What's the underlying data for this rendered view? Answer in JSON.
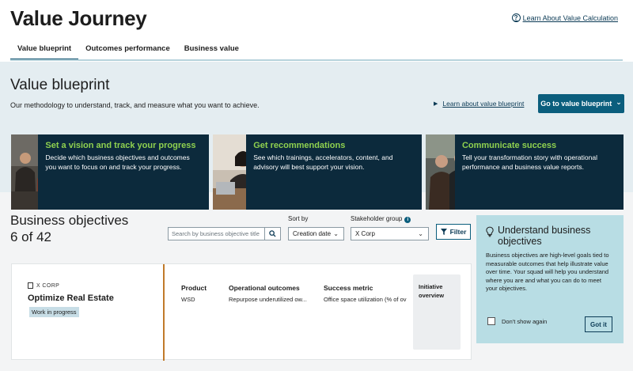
{
  "header": {
    "app_title": "Value Journey",
    "help_link": "Learn About Value Calculation"
  },
  "tabs": [
    {
      "label": "Value blueprint",
      "active": true
    },
    {
      "label": "Outcomes performance",
      "active": false
    },
    {
      "label": "Business value",
      "active": false
    }
  ],
  "blueprint": {
    "title": "Value blueprint",
    "description": "Our methodology to understand, track, and measure what you want to achieve.",
    "learn_link": "Learn about value blueprint",
    "cta": "Go to value blueprint",
    "cta_chevron": "⌄"
  },
  "cards": [
    {
      "title": "Set a vision and track your progress",
      "text": "Decide which business objectives and outcomes you want to focus on and track your progress."
    },
    {
      "title": "Get recommendations",
      "text": "See which trainings, accelerators, content, and advisory will best support your vision."
    },
    {
      "title": "Communicate success",
      "text": "Tell your transformation story with operational performance and business value reports."
    }
  ],
  "objectives": {
    "title": "Business objectives",
    "count": "6 of 42",
    "search_placeholder": "Search by business objective title",
    "sort_label": "Sort by",
    "sort_value": "Creation date",
    "stakeholder_label": "Stakeholder group",
    "stakeholder_value": "X Corp",
    "filter_label": "Filter"
  },
  "objective_card": {
    "company": "X CORP",
    "name": "Optimize Real Estate",
    "status": "Work in progress",
    "columns": [
      {
        "header": "Product",
        "value": "WSD"
      },
      {
        "header": "Operational outcomes",
        "value": "Repurpose underutilized ow..."
      },
      {
        "header": "Success metric",
        "value": "Office space utilization (% of ov"
      }
    ],
    "initiative_label": "Initiative overview"
  },
  "side_panel": {
    "title": "Understand business objectives",
    "description": "Business objectives are high-level goals tied to measurable outcomes that help illustrate value over time. Your squad will help you understand where you are and what you can do to meet your objectives.",
    "checkbox_label": "Don't show again",
    "button": "Got it"
  },
  "colors": {
    "accent": "#0b5e7d",
    "card_bg": "#0c2a3c",
    "card_title": "#8fd14f",
    "panel_bg": "#b8dde4",
    "divider": "#c07a2a"
  }
}
